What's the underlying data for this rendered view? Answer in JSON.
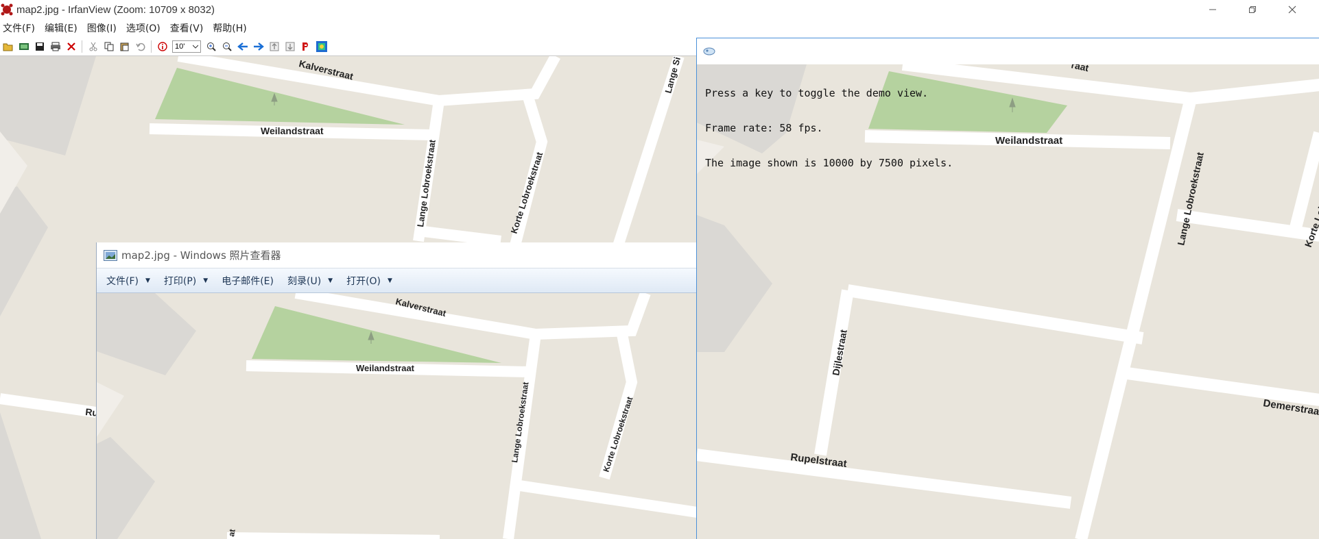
{
  "irfanview": {
    "title": "map2.jpg - IrfanView (Zoom: 10709 x 8032)",
    "menu": [
      "文件(F)",
      "编辑(E)",
      "图像(I)",
      "选项(O)",
      "查看(V)",
      "帮助(H)"
    ],
    "zoom_value": "10'",
    "map_labels": {
      "kalverstraat": "Kalverstraat",
      "weilandstraat": "Weilandstraat",
      "lange_lobroekstraat": "Lange Lobroekstraat",
      "korte_lobroekstraat": "Korte Lobroekstraat",
      "lange_si": "Lange Si",
      "ru": "Ru"
    }
  },
  "photo_viewer": {
    "title": "map2.jpg - Windows 照片查看器",
    "menu": [
      {
        "label": "文件(F)",
        "has_dropdown": true
      },
      {
        "label": "打印(P)",
        "has_dropdown": true
      },
      {
        "label": "电子邮件(E)",
        "has_dropdown": false
      },
      {
        "label": "刻录(U)",
        "has_dropdown": true
      },
      {
        "label": "打开(O)",
        "has_dropdown": true
      }
    ],
    "map_labels": {
      "kalverstraat": "Kalverstraat",
      "weilandstraat": "Weilandstraat",
      "lange_lobroekstraat": "Lange Lobroekstraat",
      "korte_lobroekstraat": "Korte Lobroekstraat",
      "at": "at"
    }
  },
  "demo": {
    "overlay_lines": [
      "Press a key to toggle the demo view.",
      "Frame rate: 58 fps.",
      "The image shown is 10000 by 7500 pixels."
    ],
    "map_labels": {
      "raat": "raat",
      "weilandstraat": "Weilandstraat",
      "lange_lobroekstraat": "Lange Lobroekstraat",
      "korte_lobroekstraat": "Korte Lobroekstraat",
      "dijlestraat": "Dijlestraat",
      "rupelstraat": "Rupelstraat",
      "demerstraat": "Demerstraa"
    }
  },
  "colors": {
    "map_bg": "#e9e5dc",
    "road": "#ffffff",
    "park": "#b5d29f",
    "building": "#d8d6d2"
  }
}
